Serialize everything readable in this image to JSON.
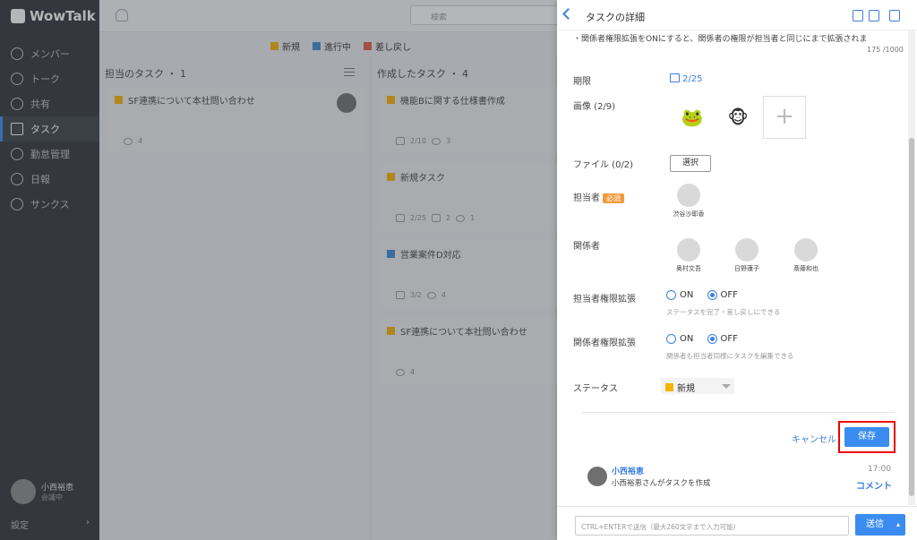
{
  "sidebar": {
    "app_name": "WowTalk",
    "items": [
      {
        "label": "メンバー"
      },
      {
        "label": "トーク"
      },
      {
        "label": "共有"
      },
      {
        "label": "タスク"
      },
      {
        "label": "勤怠管理"
      },
      {
        "label": "日報"
      },
      {
        "label": "サンクス"
      }
    ],
    "active_index": 3,
    "user_name": "小西裕恵",
    "user_status": "会議中",
    "settings": "設定"
  },
  "topbar": {
    "search_placeholder": "検索"
  },
  "legend": [
    {
      "label": "新規",
      "color": "#f5b400"
    },
    {
      "label": "進行中",
      "color": "#3b8cd6"
    },
    {
      "label": "差し戻し",
      "color": "#e05a4a"
    }
  ],
  "columns": [
    {
      "title": "担当のタスク ・ 1",
      "cards": [
        {
          "title": "SF連携について本社問い合わせ",
          "comments": "4"
        }
      ]
    },
    {
      "title": "作成したタスク ・ 4",
      "cards": [
        {
          "title": "機能Bに関する仕様書作成",
          "date": "2/10",
          "comments": "3"
        },
        {
          "title": "新規タスク",
          "date": "2/25",
          "images": "2",
          "comments": "1"
        },
        {
          "title": "営業案件D対応",
          "date": "3/2",
          "comments": "4"
        },
        {
          "title": "SF連携について本社問い合わせ",
          "comments": "4"
        }
      ]
    }
  ],
  "panel": {
    "title": "タスクの詳細",
    "desc_excerpt": "・関係者権限拡張をONにすると、関係者の権限が担当者と同じにまで拡張されま",
    "char_count": "175 /1000",
    "due_label": "期限",
    "due_value": "2/25",
    "image_label": "画像 (2/9)",
    "file_label": "ファイル (0/2)",
    "file_button": "選択",
    "assignee_label": "担当者",
    "required": "必須",
    "assignee": "渋谷沙耶香",
    "related_label": "関係者",
    "related": [
      "奥村文吾",
      "日野蓮子",
      "斎藤和也"
    ],
    "assignee_ext_label": "担当者権限拡張",
    "on": "ON",
    "off": "OFF",
    "assignee_ext_hint": "ステータスを完了・差し戻しにできる",
    "related_ext_label": "関係者権限拡張",
    "related_ext_hint": "関係者も担当者同様にタスクを編集できる",
    "status_label": "ステータス",
    "status_value": "新規",
    "cancel": "キャンセル",
    "save": "保存",
    "log_name": "小西裕恵",
    "log_text": "小西裕恵さんがタスクを作成",
    "log_time": "17:00",
    "comment": "コメント",
    "input_placeholder": "CTRL+ENTERで送信（最大260文字まで入力可能）",
    "send": "送信"
  }
}
